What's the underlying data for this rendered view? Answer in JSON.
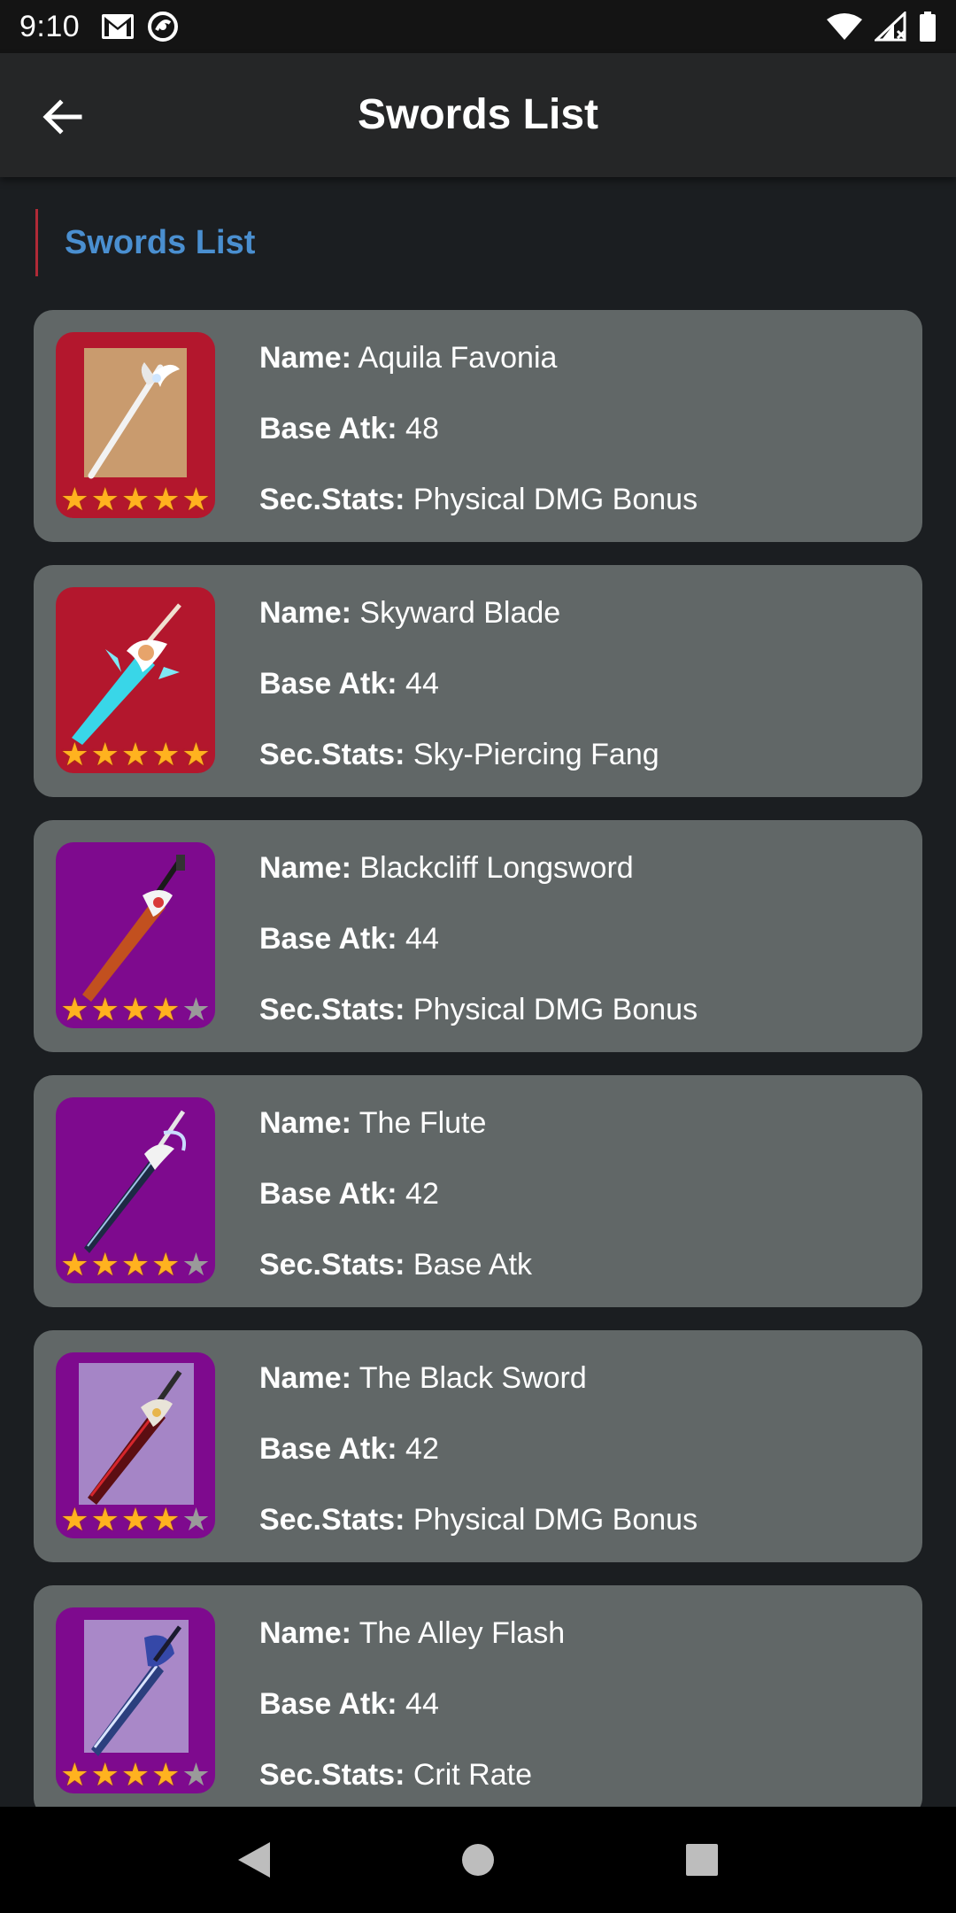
{
  "status_bar": {
    "time": "9:10"
  },
  "app_bar": {
    "title": "Swords List"
  },
  "section": {
    "title": "Swords List"
  },
  "labels": {
    "name": "Name:",
    "base_atk": "Base Atk:",
    "sec_stats": "Sec.Stats:"
  },
  "colors": {
    "five_star_bg": "#b3172d",
    "four_star_bg": "#7e0a8e",
    "card_bg": "#616767",
    "accent_blue": "#4a8fd0",
    "accent_red": "#b02a37"
  },
  "swords": [
    {
      "name": "Aquila Favonia",
      "base_atk": "48",
      "sec_stats": "Physical DMG Bonus",
      "rarity": 5
    },
    {
      "name": "Skyward Blade",
      "base_atk": "44",
      "sec_stats": "Sky-Piercing Fang",
      "rarity": 5
    },
    {
      "name": "Blackcliff Longsword",
      "base_atk": "44",
      "sec_stats": "Physical DMG Bonus",
      "rarity": 4
    },
    {
      "name": "The Flute",
      "base_atk": "42",
      "sec_stats": "Base Atk",
      "rarity": 4
    },
    {
      "name": "The Black Sword",
      "base_atk": "42",
      "sec_stats": "Physical DMG Bonus",
      "rarity": 4
    },
    {
      "name": "The Alley Flash",
      "base_atk": "44",
      "sec_stats": "Crit Rate",
      "rarity": 4
    }
  ]
}
